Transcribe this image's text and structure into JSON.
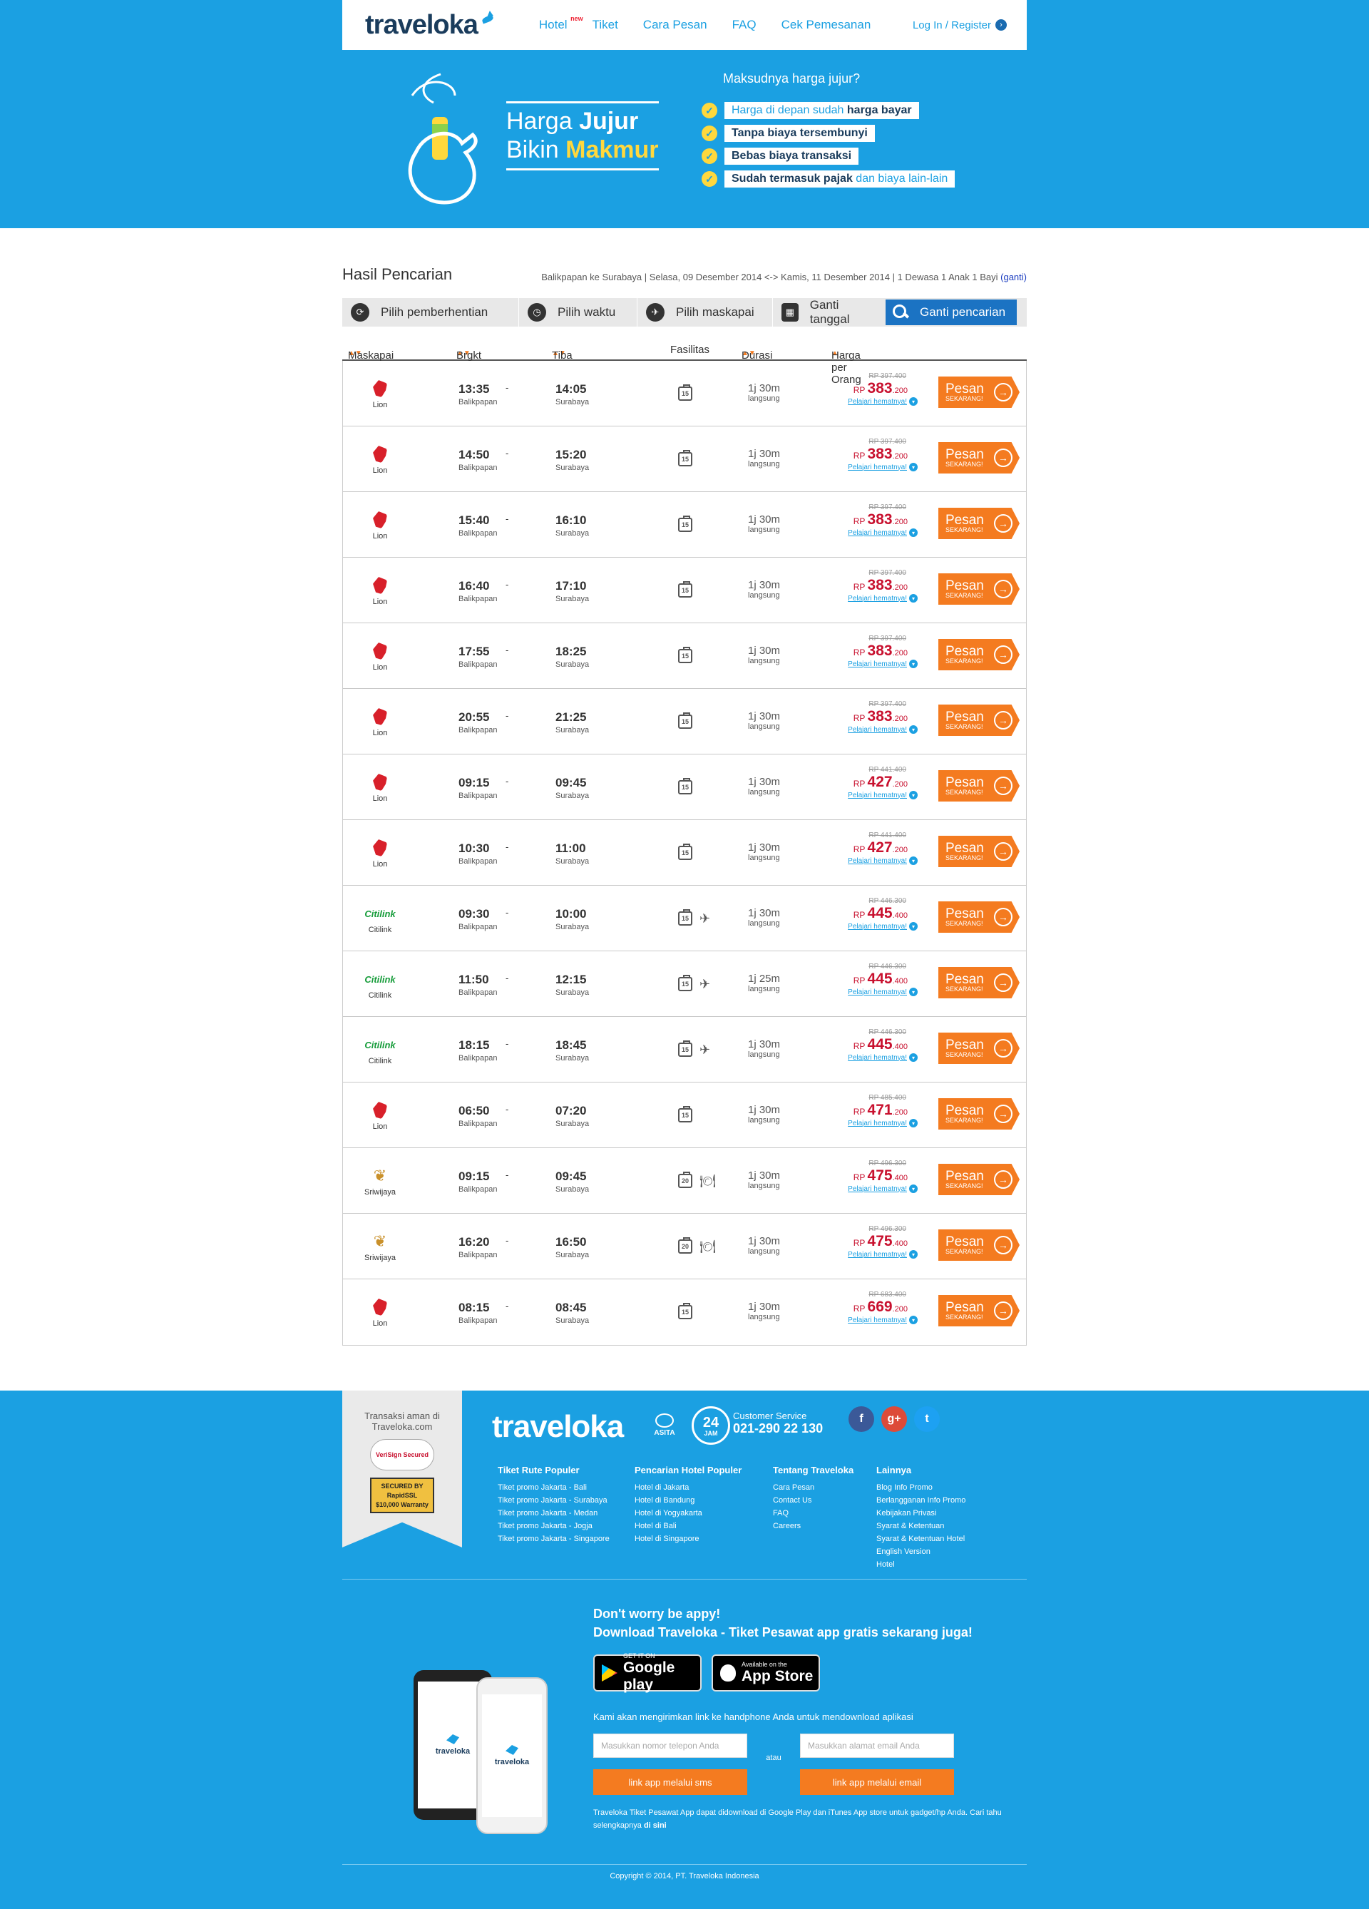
{
  "header": {
    "logo": "traveloka",
    "nav": [
      {
        "label": "Hotel",
        "badge": "new"
      },
      {
        "label": "Tiket"
      },
      {
        "label": "Cara Pesan"
      },
      {
        "label": "FAQ"
      },
      {
        "label": "Cek Pemesanan"
      }
    ],
    "login": "Log In / Register"
  },
  "hero": {
    "line1_a": "Harga ",
    "line1_b": "Jujur",
    "line2_a": "Bikin ",
    "line2_b": "Makmur",
    "question": "Maksudnya harga jujur?",
    "points": [
      {
        "text": "Harga di depan sudah ",
        "bold": "harga bayar"
      },
      {
        "text": "",
        "bold": "Tanpa biaya tersembunyi"
      },
      {
        "text": "",
        "bold": "Bebas biaya transaksi"
      },
      {
        "text": " dan biaya lain-lain",
        "bold": "Sudah termasuk pajak"
      }
    ]
  },
  "search": {
    "title": "Hasil Pencarian",
    "criteria": "Balikpapan ke Surabaya | Selasa, 09 Desember 2014 <-> Kamis, 11 Desember 2014 | 1 Dewasa 1 Anak 1 Bayi",
    "change_link": "(ganti)",
    "filters": [
      "Pilih pemberhentian",
      "Pilih waktu",
      "Pilih maskapai",
      "Ganti tanggal"
    ],
    "search_button": "Ganti pencarian"
  },
  "table": {
    "headers": [
      "Maskapai",
      "Brgkt",
      "Tiba",
      "Fasilitas",
      "Durasi",
      "Harga per Orang"
    ],
    "learn_label": "Pelajari hematnya!",
    "book_label": "Pesan",
    "book_sub": "SEKARANG!",
    "currency": "RP",
    "rows": [
      {
        "airline": "Lion",
        "logo": "lion",
        "dep": "13:35",
        "dep_city": "Balikpapan",
        "arr": "14:05",
        "arr_city": "Surabaya",
        "bag": "15",
        "meal": false,
        "plane": false,
        "dur": "1j 30m",
        "stop": "langsung",
        "old": "RP 397.400",
        "main": "383",
        "dec": ".200"
      },
      {
        "airline": "Lion",
        "logo": "lion",
        "dep": "14:50",
        "dep_city": "Balikpapan",
        "arr": "15:20",
        "arr_city": "Surabaya",
        "bag": "15",
        "meal": false,
        "plane": false,
        "dur": "1j 30m",
        "stop": "langsung",
        "old": "RP 397.400",
        "main": "383",
        "dec": ".200"
      },
      {
        "airline": "Lion",
        "logo": "lion",
        "dep": "15:40",
        "dep_city": "Balikpapan",
        "arr": "16:10",
        "arr_city": "Surabaya",
        "bag": "15",
        "meal": false,
        "plane": false,
        "dur": "1j 30m",
        "stop": "langsung",
        "old": "RP 397.400",
        "main": "383",
        "dec": ".200"
      },
      {
        "airline": "Lion",
        "logo": "lion",
        "dep": "16:40",
        "dep_city": "Balikpapan",
        "arr": "17:10",
        "arr_city": "Surabaya",
        "bag": "15",
        "meal": false,
        "plane": false,
        "dur": "1j 30m",
        "stop": "langsung",
        "old": "RP 397.400",
        "main": "383",
        "dec": ".200"
      },
      {
        "airline": "Lion",
        "logo": "lion",
        "dep": "17:55",
        "dep_city": "Balikpapan",
        "arr": "18:25",
        "arr_city": "Surabaya",
        "bag": "15",
        "meal": false,
        "plane": false,
        "dur": "1j 30m",
        "stop": "langsung",
        "old": "RP 397.400",
        "main": "383",
        "dec": ".200"
      },
      {
        "airline": "Lion",
        "logo": "lion",
        "dep": "20:55",
        "dep_city": "Balikpapan",
        "arr": "21:25",
        "arr_city": "Surabaya",
        "bag": "15",
        "meal": false,
        "plane": false,
        "dur": "1j 30m",
        "stop": "langsung",
        "old": "RP 397.400",
        "main": "383",
        "dec": ".200"
      },
      {
        "airline": "Lion",
        "logo": "lion",
        "dep": "09:15",
        "dep_city": "Balikpapan",
        "arr": "09:45",
        "arr_city": "Surabaya",
        "bag": "15",
        "meal": false,
        "plane": false,
        "dur": "1j 30m",
        "stop": "langsung",
        "old": "RP 441.400",
        "main": "427",
        "dec": ".200"
      },
      {
        "airline": "Lion",
        "logo": "lion",
        "dep": "10:30",
        "dep_city": "Balikpapan",
        "arr": "11:00",
        "arr_city": "Surabaya",
        "bag": "15",
        "meal": false,
        "plane": false,
        "dur": "1j 30m",
        "stop": "langsung",
        "old": "RP 441.400",
        "main": "427",
        "dec": ".200"
      },
      {
        "airline": "Citilink",
        "logo": "citilink",
        "dep": "09:30",
        "dep_city": "Balikpapan",
        "arr": "10:00",
        "arr_city": "Surabaya",
        "bag": "15",
        "meal": false,
        "plane": true,
        "dur": "1j 30m",
        "stop": "langsung",
        "old": "RP 446.300",
        "main": "445",
        "dec": ".400"
      },
      {
        "airline": "Citilink",
        "logo": "citilink",
        "dep": "11:50",
        "dep_city": "Balikpapan",
        "arr": "12:15",
        "arr_city": "Surabaya",
        "bag": "15",
        "meal": false,
        "plane": true,
        "dur": "1j 25m",
        "stop": "langsung",
        "old": "RP 446.300",
        "main": "445",
        "dec": ".400"
      },
      {
        "airline": "Citilink",
        "logo": "citilink",
        "dep": "18:15",
        "dep_city": "Balikpapan",
        "arr": "18:45",
        "arr_city": "Surabaya",
        "bag": "15",
        "meal": false,
        "plane": true,
        "dur": "1j 30m",
        "stop": "langsung",
        "old": "RP 446.300",
        "main": "445",
        "dec": ".400"
      },
      {
        "airline": "Lion",
        "logo": "lion",
        "dep": "06:50",
        "dep_city": "Balikpapan",
        "arr": "07:20",
        "arr_city": "Surabaya",
        "bag": "15",
        "meal": false,
        "plane": false,
        "dur": "1j 30m",
        "stop": "langsung",
        "old": "RP 485.400",
        "main": "471",
        "dec": ".200"
      },
      {
        "airline": "Sriwijaya",
        "logo": "sriwijaya",
        "dep": "09:15",
        "dep_city": "Balikpapan",
        "arr": "09:45",
        "arr_city": "Surabaya",
        "bag": "20",
        "meal": true,
        "plane": false,
        "dur": "1j 30m",
        "stop": "langsung",
        "old": "RP 496.300",
        "main": "475",
        "dec": ".400"
      },
      {
        "airline": "Sriwijaya",
        "logo": "sriwijaya",
        "dep": "16:20",
        "dep_city": "Balikpapan",
        "arr": "16:50",
        "arr_city": "Surabaya",
        "bag": "20",
        "meal": true,
        "plane": false,
        "dur": "1j 30m",
        "stop": "langsung",
        "old": "RP 496.300",
        "main": "475",
        "dec": ".400"
      },
      {
        "airline": "Lion",
        "logo": "lion",
        "dep": "08:15",
        "dep_city": "Balikpapan",
        "arr": "08:45",
        "arr_city": "Surabaya",
        "bag": "15",
        "meal": false,
        "plane": false,
        "dur": "1j 30m",
        "stop": "langsung",
        "old": "RP 683.400",
        "main": "669",
        "dec": ".200"
      }
    ]
  },
  "footer": {
    "secure_text": "Transaksi aman di Traveloka.com",
    "verisign": "VeriSign Secured",
    "rapidssl": [
      "SECURED BY",
      "RapidSSL",
      "$10,000 Warranty"
    ],
    "logo": "traveloka",
    "asita": "ASITA",
    "hours": "24",
    "hours_unit": "JAM",
    "cs_label": "Customer Service",
    "cs_phone": "021-290 22 130",
    "social": [
      "f",
      "g+",
      "t"
    ],
    "columns": [
      {
        "title": "Tiket Rute Populer",
        "items": [
          "Tiket promo Jakarta - Bali",
          "Tiket promo Jakarta - Surabaya",
          "Tiket promo Jakarta - Medan",
          "Tiket promo Jakarta - Jogja",
          "Tiket promo Jakarta - Singapore"
        ]
      },
      {
        "title": "Pencarian Hotel Populer",
        "items": [
          "Hotel di Jakarta",
          "Hotel di Bandung",
          "Hotel di Yogyakarta",
          "Hotel di Bali",
          "Hotel di Singapore"
        ]
      },
      {
        "title": "Tentang Traveloka",
        "items": [
          "Cara Pesan",
          "Contact Us",
          "FAQ",
          "Careers"
        ]
      },
      {
        "title": "Lainnya",
        "items": [
          "Blog Info Promo",
          "Berlangganan Info Promo",
          "Kebijakan Privasi",
          "Syarat & Ketentuan",
          "Syarat & Ketentuan Hotel",
          "English Version",
          "Hotel"
        ]
      }
    ],
    "app_title1": "Don't worry be appy!",
    "app_title2": "Download Traveloka - Tiket Pesawat app gratis sekarang juga!",
    "gp_small": "GET IT ON",
    "gp_big": "Google play",
    "as_small": "Available on the",
    "as_big": "App Store",
    "note": "Kami akan mengirimkan link ke handphone Anda untuk mendownload aplikasi",
    "phone_placeholder": "Masukkan nomor telepon Anda",
    "email_placeholder": "Masukkan alamat email Anda",
    "or": "atau",
    "sms_button": "link app melalui sms",
    "email_button": "link app melalui email",
    "desc": "Traveloka Tiket Pesawat App dapat didownload di Google Play dan iTunes App store untuk gadget/hp Anda. Cari tahu selengkapnya",
    "desc_link": "di sini",
    "phone_screen": "traveloka",
    "copyright": "Copyright © 2014, PT. Traveloka Indonesia"
  },
  "colors": {
    "brand": "#1ba0e2",
    "accent": "#f47b20",
    "price": "#c8102e",
    "lion": "#d8202a",
    "citilink": "#169c3a"
  }
}
